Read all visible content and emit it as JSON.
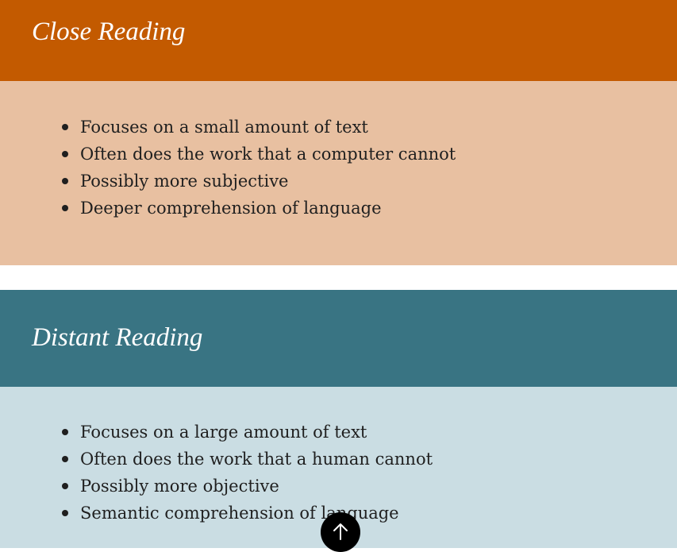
{
  "sections": [
    {
      "title": "Close Reading",
      "header_color": "#c35a00",
      "panel_color": "#e8c0a1",
      "points": [
        "Focuses on a small amount of text",
        "Often does the work that a computer cannot",
        "Possibly more subjective",
        "Deeper comprehension of language"
      ]
    },
    {
      "title": "Distant Reading",
      "header_color": "#397483",
      "panel_color": "#cadde3",
      "points": [
        "Focuses on a large amount of text",
        "Often does the work that a human cannot",
        "Possibly more objective",
        "Semantic comprehension of language"
      ]
    }
  ],
  "back_to_top": {
    "icon": "arrow-up-icon"
  }
}
